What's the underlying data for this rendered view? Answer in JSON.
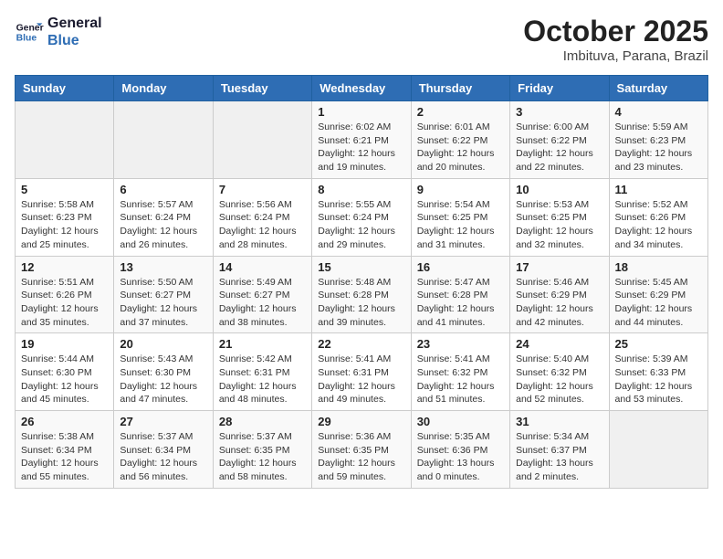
{
  "header": {
    "logo_line1": "General",
    "logo_line2": "Blue",
    "month_year": "October 2025",
    "location": "Imbituva, Parana, Brazil"
  },
  "weekdays": [
    "Sunday",
    "Monday",
    "Tuesday",
    "Wednesday",
    "Thursday",
    "Friday",
    "Saturday"
  ],
  "weeks": [
    [
      {
        "day": "",
        "info": ""
      },
      {
        "day": "",
        "info": ""
      },
      {
        "day": "",
        "info": ""
      },
      {
        "day": "1",
        "info": "Sunrise: 6:02 AM\nSunset: 6:21 PM\nDaylight: 12 hours\nand 19 minutes."
      },
      {
        "day": "2",
        "info": "Sunrise: 6:01 AM\nSunset: 6:22 PM\nDaylight: 12 hours\nand 20 minutes."
      },
      {
        "day": "3",
        "info": "Sunrise: 6:00 AM\nSunset: 6:22 PM\nDaylight: 12 hours\nand 22 minutes."
      },
      {
        "day": "4",
        "info": "Sunrise: 5:59 AM\nSunset: 6:23 PM\nDaylight: 12 hours\nand 23 minutes."
      }
    ],
    [
      {
        "day": "5",
        "info": "Sunrise: 5:58 AM\nSunset: 6:23 PM\nDaylight: 12 hours\nand 25 minutes."
      },
      {
        "day": "6",
        "info": "Sunrise: 5:57 AM\nSunset: 6:24 PM\nDaylight: 12 hours\nand 26 minutes."
      },
      {
        "day": "7",
        "info": "Sunrise: 5:56 AM\nSunset: 6:24 PM\nDaylight: 12 hours\nand 28 minutes."
      },
      {
        "day": "8",
        "info": "Sunrise: 5:55 AM\nSunset: 6:24 PM\nDaylight: 12 hours\nand 29 minutes."
      },
      {
        "day": "9",
        "info": "Sunrise: 5:54 AM\nSunset: 6:25 PM\nDaylight: 12 hours\nand 31 minutes."
      },
      {
        "day": "10",
        "info": "Sunrise: 5:53 AM\nSunset: 6:25 PM\nDaylight: 12 hours\nand 32 minutes."
      },
      {
        "day": "11",
        "info": "Sunrise: 5:52 AM\nSunset: 6:26 PM\nDaylight: 12 hours\nand 34 minutes."
      }
    ],
    [
      {
        "day": "12",
        "info": "Sunrise: 5:51 AM\nSunset: 6:26 PM\nDaylight: 12 hours\nand 35 minutes."
      },
      {
        "day": "13",
        "info": "Sunrise: 5:50 AM\nSunset: 6:27 PM\nDaylight: 12 hours\nand 37 minutes."
      },
      {
        "day": "14",
        "info": "Sunrise: 5:49 AM\nSunset: 6:27 PM\nDaylight: 12 hours\nand 38 minutes."
      },
      {
        "day": "15",
        "info": "Sunrise: 5:48 AM\nSunset: 6:28 PM\nDaylight: 12 hours\nand 39 minutes."
      },
      {
        "day": "16",
        "info": "Sunrise: 5:47 AM\nSunset: 6:28 PM\nDaylight: 12 hours\nand 41 minutes."
      },
      {
        "day": "17",
        "info": "Sunrise: 5:46 AM\nSunset: 6:29 PM\nDaylight: 12 hours\nand 42 minutes."
      },
      {
        "day": "18",
        "info": "Sunrise: 5:45 AM\nSunset: 6:29 PM\nDaylight: 12 hours\nand 44 minutes."
      }
    ],
    [
      {
        "day": "19",
        "info": "Sunrise: 5:44 AM\nSunset: 6:30 PM\nDaylight: 12 hours\nand 45 minutes."
      },
      {
        "day": "20",
        "info": "Sunrise: 5:43 AM\nSunset: 6:30 PM\nDaylight: 12 hours\nand 47 minutes."
      },
      {
        "day": "21",
        "info": "Sunrise: 5:42 AM\nSunset: 6:31 PM\nDaylight: 12 hours\nand 48 minutes."
      },
      {
        "day": "22",
        "info": "Sunrise: 5:41 AM\nSunset: 6:31 PM\nDaylight: 12 hours\nand 49 minutes."
      },
      {
        "day": "23",
        "info": "Sunrise: 5:41 AM\nSunset: 6:32 PM\nDaylight: 12 hours\nand 51 minutes."
      },
      {
        "day": "24",
        "info": "Sunrise: 5:40 AM\nSunset: 6:32 PM\nDaylight: 12 hours\nand 52 minutes."
      },
      {
        "day": "25",
        "info": "Sunrise: 5:39 AM\nSunset: 6:33 PM\nDaylight: 12 hours\nand 53 minutes."
      }
    ],
    [
      {
        "day": "26",
        "info": "Sunrise: 5:38 AM\nSunset: 6:34 PM\nDaylight: 12 hours\nand 55 minutes."
      },
      {
        "day": "27",
        "info": "Sunrise: 5:37 AM\nSunset: 6:34 PM\nDaylight: 12 hours\nand 56 minutes."
      },
      {
        "day": "28",
        "info": "Sunrise: 5:37 AM\nSunset: 6:35 PM\nDaylight: 12 hours\nand 58 minutes."
      },
      {
        "day": "29",
        "info": "Sunrise: 5:36 AM\nSunset: 6:35 PM\nDaylight: 12 hours\nand 59 minutes."
      },
      {
        "day": "30",
        "info": "Sunrise: 5:35 AM\nSunset: 6:36 PM\nDaylight: 13 hours\nand 0 minutes."
      },
      {
        "day": "31",
        "info": "Sunrise: 5:34 AM\nSunset: 6:37 PM\nDaylight: 13 hours\nand 2 minutes."
      },
      {
        "day": "",
        "info": ""
      }
    ]
  ]
}
